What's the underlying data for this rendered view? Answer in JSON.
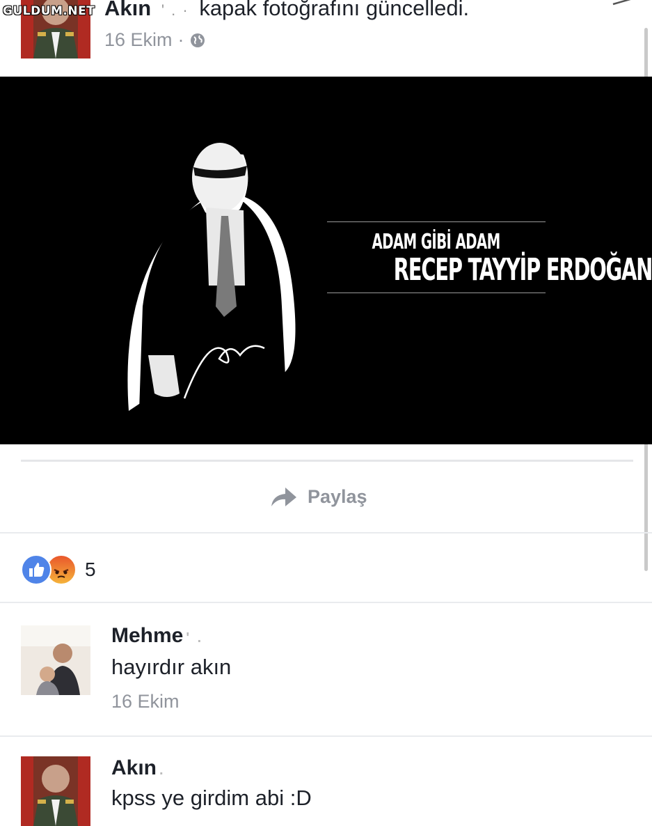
{
  "watermark": "GULDUM.NET",
  "post": {
    "author": "Akın",
    "author_mask": "' . ·",
    "action": "kapak fotoğrafını güncelledi.",
    "date": "16 Ekim",
    "separator": "·",
    "privacy_icon": "globe-icon",
    "menu_icon": "chevron-down-icon"
  },
  "cover": {
    "line1": "ADAM GİBİ ADAM",
    "line2": "RECEP TAYYİP ERDOĞAN"
  },
  "actions": {
    "share_icon": "share-arrow-icon",
    "share_label": "Paylaş"
  },
  "reactions": {
    "icons": [
      "like-icon",
      "angry-icon"
    ],
    "count": "5"
  },
  "comments": [
    {
      "name": "Mehme",
      "name_mask": "'  .",
      "text": "hayırdır akın",
      "time": "16 Ekim"
    },
    {
      "name": "Akın",
      "name_mask": ".",
      "text": "kpss ye girdim abi :D"
    }
  ],
  "colors": {
    "text": "#1d2129",
    "meta": "#90949c",
    "like": "#4f84e8",
    "angry": "#e9572c"
  }
}
